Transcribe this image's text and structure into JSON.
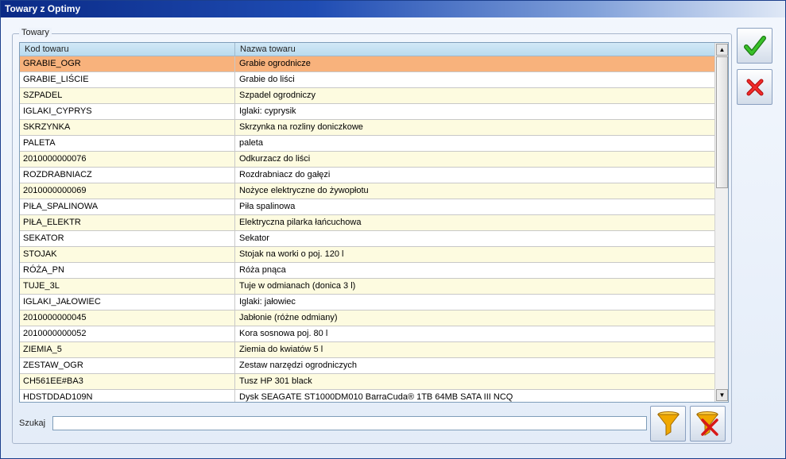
{
  "window": {
    "title": "Towary z Optimy"
  },
  "group": {
    "label": "Towary"
  },
  "grid": {
    "columns": [
      "Kod towaru",
      "Nazwa towaru"
    ],
    "selected_index": 0,
    "rows": [
      {
        "code": "GRABIE_OGR",
        "name": "Grabie ogrodnicze"
      },
      {
        "code": "GRABIE_LIŚCIE",
        "name": "Grabie do liści"
      },
      {
        "code": "SZPADEL",
        "name": "Szpadel ogrodniczy"
      },
      {
        "code": "IGLAKI_CYPRYS",
        "name": "Iglaki: cyprysik"
      },
      {
        "code": "SKRZYNKA",
        "name": "Skrzynka na rozliny doniczkowe"
      },
      {
        "code": "PALETA",
        "name": "paleta"
      },
      {
        "code": "2010000000076",
        "name": "Odkurzacz do liści"
      },
      {
        "code": "ROZDRABNIACZ",
        "name": "Rozdrabniacz do gałęzi"
      },
      {
        "code": "2010000000069",
        "name": "Nożyce elektryczne do żywopłotu"
      },
      {
        "code": "PIŁA_SPALINOWA",
        "name": "Piła spalinowa"
      },
      {
        "code": "PIŁA_ELEKTR",
        "name": "Elektryczna pilarka łańcuchowa"
      },
      {
        "code": "SEKATOR",
        "name": "Sekator"
      },
      {
        "code": "STOJAK",
        "name": "Stojak na worki o poj. 120 l"
      },
      {
        "code": "RÓŻA_PN",
        "name": "Róża pnąca"
      },
      {
        "code": "TUJE_3L",
        "name": "Tuje w odmianach (donica 3 l)"
      },
      {
        "code": "IGLAKI_JAŁOWIEC",
        "name": "Iglaki: jałowiec"
      },
      {
        "code": "2010000000045",
        "name": "Jabłonie (różne odmiany)"
      },
      {
        "code": "2010000000052",
        "name": "Kora sosnowa poj. 80 l"
      },
      {
        "code": "ZIEMIA_5",
        "name": "Ziemia do kwiatów 5 l"
      },
      {
        "code": "ZESTAW_OGR",
        "name": "Zestaw narzędzi ogrodniczych"
      },
      {
        "code": "CH561EE#BA3",
        "name": "Tusz HP 301 black"
      },
      {
        "code": "HDSTDDAD109N",
        "name": "Dysk SEAGATE ST1000DM010 BarraCuda® 1TB 64MB SATA III NCQ"
      }
    ]
  },
  "search": {
    "label": "Szukaj",
    "value": ""
  },
  "buttons": {
    "ok_icon": "checkmark-icon",
    "cancel_icon": "x-mark-icon",
    "filter_icon": "funnel-icon",
    "clear_filter_icon": "funnel-remove-icon"
  },
  "colors": {
    "selected_row": "#f8b27c",
    "odd_row": "#fdfbe0",
    "header": "#c6e2f3",
    "ok_green": "#2aa01f",
    "cancel_red": "#e01818",
    "funnel_gold": "#f0a800"
  }
}
